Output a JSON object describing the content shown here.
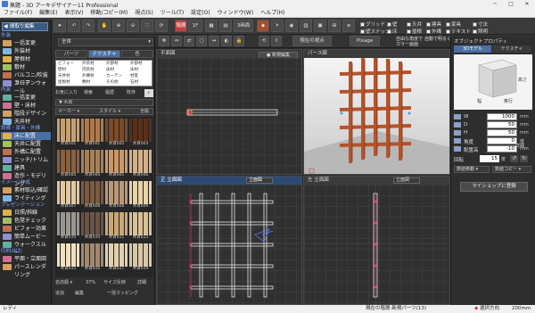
{
  "window": {
    "title": "無題 - 3D アーキデザイナー11 Professional",
    "menus": [
      "ファイル(F)",
      "編集(E)",
      "表示(V)",
      "移動/コピー(M)",
      "視点(S)",
      "ツール(T)",
      "設定(O)",
      "ウィンドウ(W)",
      "ヘルプ(H)"
    ]
  },
  "toolbar": {
    "level_label": "階層",
    "level_value": "1F",
    "view_mode": "3画面",
    "checks": [
      "グリッド",
      "壁スナップ",
      "壁",
      "床",
      "天井",
      "屋根",
      "建具",
      "外構",
      "家具",
      "テキスト",
      "寸法",
      "照明"
    ],
    "row2": {
      "current_view": "現在の視点",
      "pixage": "Pixage",
      "free_angle": "自由な角度で",
      "auto_light": "自動で明るく",
      "render_mode": "カラー画面"
    }
  },
  "left_panel": {
    "top_button": "間取り編集",
    "sections": [
      {
        "title": "外装",
        "items": [
          "一括変更",
          "外装材",
          "屋根材",
          "敷材",
          "バルコニ/吹抜フロア",
          "カーテンウォール"
        ]
      },
      {
        "title": "内装",
        "items": [
          "一括変更",
          "壁・床材",
          "階段デザイン",
          "天井材"
        ]
      },
      {
        "title": "設備・家具・外構",
        "items": [
          "床に配置",
          "天井に配置",
          "外構に配置",
          "ニッチ/トリム",
          "建具",
          "造作・モデリング"
        ]
      },
      {
        "title": "イメージ作成",
        "items": [
          "素材取込/確認",
          "ライティング"
        ]
      },
      {
        "title": "プレゼンテーション",
        "items": [
          "日照/斜線",
          "色覚チェック",
          "ビフォー効果",
          "簡単ムービー",
          "ウォークスルー"
        ]
      },
      {
        "title": "印刷/出力",
        "items": [
          "平面・立面図",
          "パースレンダリング"
        ]
      }
    ],
    "selected": "床に配置"
  },
  "material_panel": {
    "category_dropdown": "全体",
    "tabs": [
      "パーツ",
      "テクスチャ",
      "色"
    ],
    "active_tab": "テクスチャ",
    "categories": [
      "ビフォー",
      "外装材",
      "外部材",
      "外部材",
      "壁材",
      "内装材",
      "床材",
      "床材",
      "天井材",
      "外構材",
      "カーテン",
      "材質",
      "屋根材",
      "敷材",
      "その他",
      "石材"
    ],
    "subtabs": [
      "お気に入り",
      "検索",
      "履歴",
      "既存"
    ],
    "tree": "▼ 木目",
    "dropdowns": [
      "メーカー",
      "スタイル"
    ],
    "dropdown_right": "全般",
    "textures": [
      {
        "label": "木目001",
        "color": "#c8a070"
      },
      {
        "label": "木目001",
        "color": "#b07a48"
      },
      {
        "label": "木目002",
        "color": "#7a4a2a"
      },
      {
        "label": "木目003",
        "color": "#5a3018"
      },
      {
        "label": "木目004",
        "color": "#8a6040"
      },
      {
        "label": "木目004",
        "color": "#a88058"
      },
      {
        "label": "木目005",
        "color": "#c89868"
      },
      {
        "label": "木目006",
        "color": "#d4b088"
      },
      {
        "label": "木目007",
        "color": "#e0c8a0"
      },
      {
        "label": "木目008",
        "color": "#7a5a40"
      },
      {
        "label": "木目008",
        "color": "#b89878"
      },
      {
        "label": "木目009",
        "color": "#e8d4a8"
      },
      {
        "label": "木目010",
        "color": "#9a9690"
      },
      {
        "label": "木目010",
        "color": "#6a5448"
      },
      {
        "label": "木目011",
        "color": "#c8a878"
      },
      {
        "label": "木目013",
        "color": "#d8c098"
      },
      {
        "label": "木目015",
        "color": "#f0e0c0"
      },
      {
        "label": "木目016",
        "color": "#a08870"
      },
      {
        "label": "木目017",
        "color": "#e0d0b0"
      },
      {
        "label": "木目019",
        "color": "#d8c8a8"
      }
    ],
    "footer": [
      "名前順",
      "37%",
      "サイズ反映",
      "詳細"
    ],
    "footer2": [
      "追加",
      "編集",
      "一括マッピング"
    ]
  },
  "viewports": {
    "plan": {
      "title": "平面図",
      "label": "新規編集"
    },
    "perspective": {
      "title": "パース図"
    },
    "front": {
      "title": "正 立面図",
      "dropdown": "立面図"
    },
    "side": {
      "title": "左 立面図",
      "dropdown": "立面図"
    }
  },
  "right_panel": {
    "title": "オブジェクトプロパティ",
    "tabs": [
      "3Dモデル",
      "テクスチャ"
    ],
    "preview_labels": {
      "height": "高さ",
      "width": "幅",
      "depth": "奥行"
    },
    "fields": [
      {
        "label": "W",
        "value": "1000",
        "unit": "mm"
      },
      {
        "label": "D",
        "value": "50",
        "unit": "mm"
      },
      {
        "label": "H",
        "value": "50",
        "unit": "mm"
      },
      {
        "label": "角度",
        "value": "0",
        "unit": "度"
      },
      {
        "label": "配置高",
        "value": "-10",
        "unit": "mm"
      }
    ],
    "rotation_label": "回転",
    "rotation_value": "15",
    "rotation_unit": "度",
    "move_label": "数値移動",
    "copy_label": "数値コピー",
    "shape_button": "マイショップに登録",
    "reset": "詳細"
  },
  "status": {
    "left": "レディ",
    "center": "現在の階層:新規パーツ(13)",
    "tool": "選択方向",
    "zoom": "200mm"
  },
  "colors": {
    "accent": "#4a6fa5",
    "wood": "#b5532a",
    "bg": "#2b2b2b"
  }
}
